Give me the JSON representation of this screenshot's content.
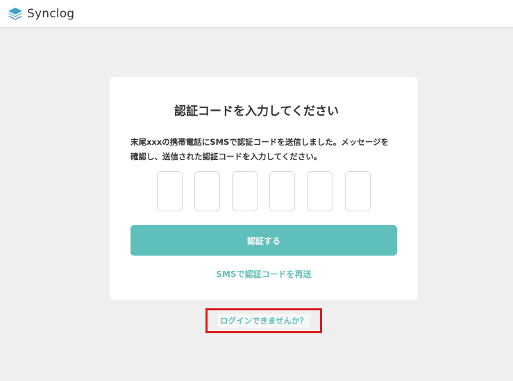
{
  "brand": {
    "name": "Synclog",
    "logo_icon": "stacked-layers-logo-icon",
    "accent_color": "#5fbfba"
  },
  "verification": {
    "title": "認証コードを入力してください",
    "description_line1": "末尾xxxの携帯電話にSMSで認証コードを送信しました。メッセージを",
    "description_line2": "確認し、送信された認証コードを入力してください。",
    "code_length": 6,
    "code_digits": [
      "",
      "",
      "",
      "",
      "",
      ""
    ],
    "submit_label": "認証する",
    "resend_label": "SMSで認証コードを再送"
  },
  "footer": {
    "cant_login_label": "ログインできませんか？",
    "highlight_color": "#e0191e"
  }
}
